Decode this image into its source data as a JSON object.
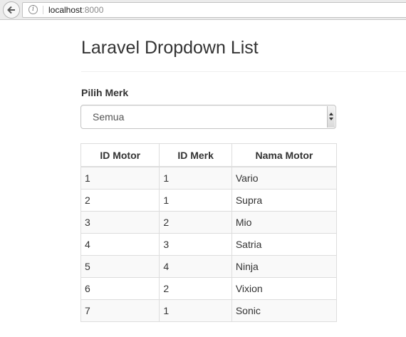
{
  "browser": {
    "url_host": "localhost",
    "url_port": ":8000"
  },
  "page": {
    "title": "Laravel Dropdown List",
    "filter_label": "Pilih Merk",
    "filter_selected": "Semua"
  },
  "table": {
    "headers": [
      "ID Motor",
      "ID Merk",
      "Nama Motor"
    ],
    "rows": [
      [
        "1",
        "1",
        "Vario"
      ],
      [
        "2",
        "1",
        "Supra"
      ],
      [
        "3",
        "2",
        "Mio"
      ],
      [
        "4",
        "3",
        "Satria"
      ],
      [
        "5",
        "4",
        "Ninja"
      ],
      [
        "6",
        "2",
        "Vixion"
      ],
      [
        "7",
        "1",
        "Sonic"
      ]
    ]
  }
}
